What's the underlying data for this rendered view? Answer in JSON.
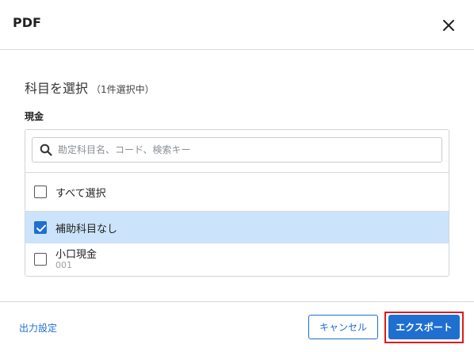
{
  "dialog": {
    "title": "PDF",
    "close_icon": "close-icon"
  },
  "selection": {
    "heading": "科目を選択",
    "count_text": "（1件選択中）"
  },
  "account": {
    "name": "現金"
  },
  "search": {
    "placeholder": "勘定科目名、コード、検索キー",
    "value": "",
    "icon": "search-icon"
  },
  "list": {
    "select_all_label": "すべて選択",
    "select_all_checked": false,
    "items": [
      {
        "label": "補助科目なし",
        "code": "",
        "checked": true
      },
      {
        "label": "小口現金",
        "code": "001",
        "checked": false
      }
    ]
  },
  "footer": {
    "output_settings_label": "出力設定",
    "cancel_label": "キャンセル",
    "export_label": "エクスポート"
  },
  "colors": {
    "accent": "#1f6fd1",
    "selected_row_bg": "#cce4fb",
    "highlight_outline": "#e01b1b"
  }
}
